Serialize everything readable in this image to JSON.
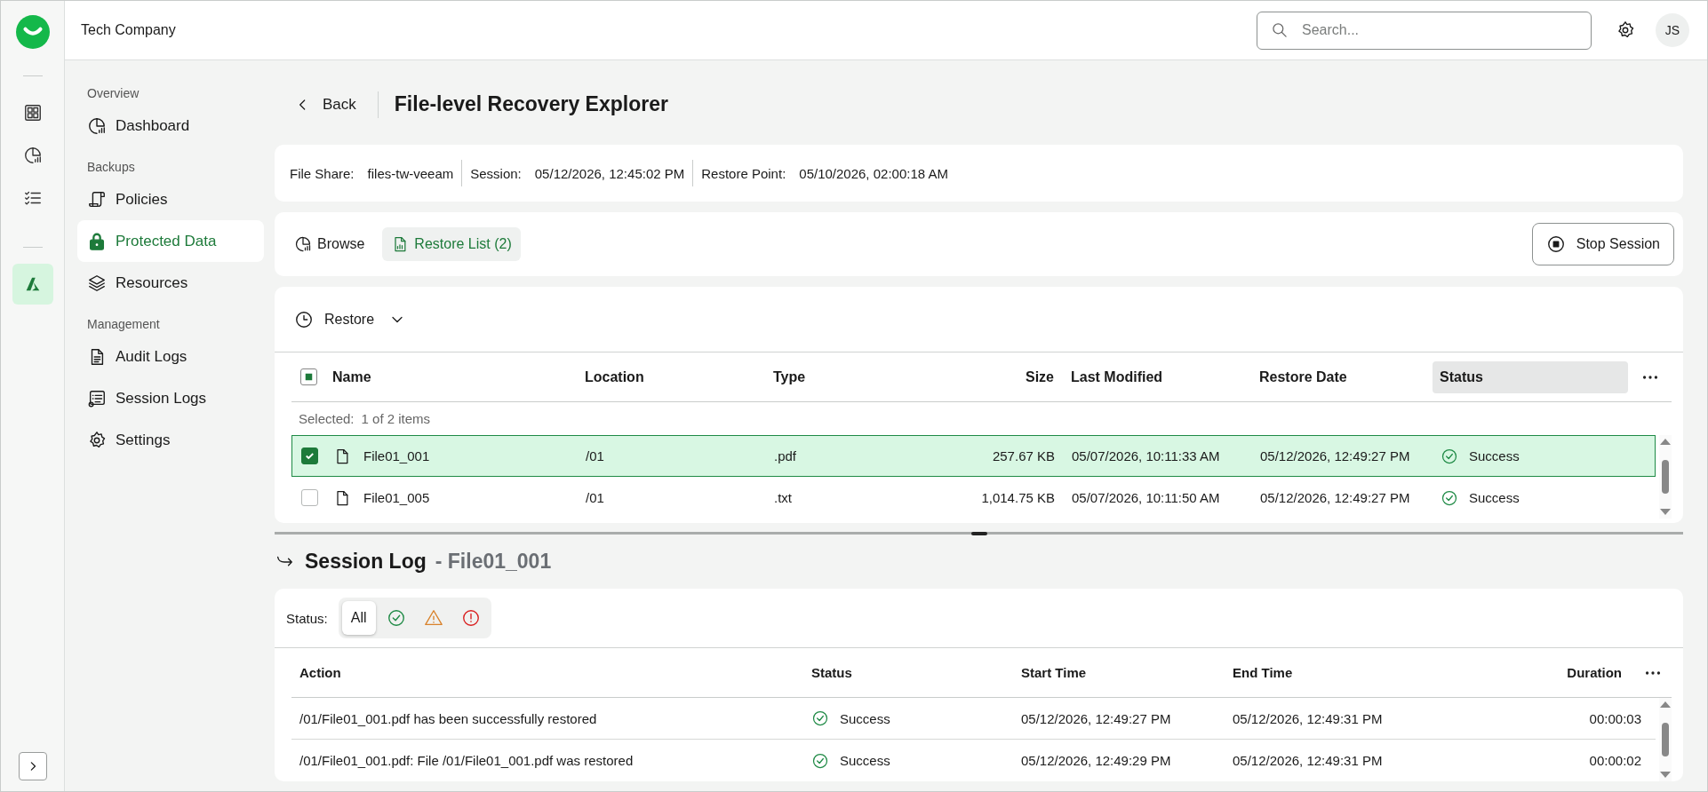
{
  "header": {
    "company": "Tech Company",
    "search_placeholder": "Search...",
    "avatar": "JS"
  },
  "rail": [
    {
      "kind": "grid",
      "selected": false
    },
    {
      "kind": "chart",
      "selected": false
    },
    {
      "kind": "checklist",
      "selected": false
    },
    {
      "kind": "azure",
      "selected": true
    }
  ],
  "sidebar": [
    {
      "label": "Overview",
      "items": [
        {
          "kind": "chart",
          "label": "Dashboard",
          "selected": false
        }
      ]
    },
    {
      "label": "Backups",
      "items": [
        {
          "kind": "scroll",
          "label": "Policies",
          "selected": false
        },
        {
          "kind": "lock",
          "label": "Protected Data",
          "selected": true
        },
        {
          "kind": "layers",
          "label": "Resources",
          "selected": false
        }
      ]
    },
    {
      "label": "Management",
      "items": [
        {
          "kind": "doc",
          "label": "Audit Logs",
          "selected": false
        },
        {
          "kind": "log",
          "label": "Session Logs",
          "selected": false
        },
        {
          "kind": "gear",
          "label": "Settings",
          "selected": false
        }
      ]
    }
  ],
  "page": {
    "back": "Back",
    "title": "File-level Recovery Explorer"
  },
  "info": [
    {
      "label": "File Share:",
      "value": "files-tw-veeam"
    },
    {
      "label": "Session:",
      "value": "05/12/2026, 12:45:02 PM"
    },
    {
      "label": "Restore Point:",
      "value": "05/10/2026, 02:00:18 AM"
    }
  ],
  "tabs": [
    {
      "kind": "chart",
      "label": "Browse",
      "selected": false
    },
    {
      "kind": "report",
      "label": "Restore List (2)",
      "selected": true
    }
  ],
  "stop_button": "Stop Session",
  "restore_menu": "Restore",
  "files": {
    "select_all": {
      "checked": true,
      "partial": true
    },
    "columns": [
      {
        "label": "Name",
        "kind": "text",
        "highlighted": false
      },
      {
        "label": "Location",
        "kind": "text",
        "highlighted": false
      },
      {
        "label": "Type",
        "kind": "text",
        "highlighted": false
      },
      {
        "label": "Size",
        "kind": "number",
        "highlighted": false
      },
      {
        "label": "Last Modified",
        "kind": "text",
        "highlighted": false
      },
      {
        "label": "Restore Date",
        "kind": "text",
        "highlighted": false
      },
      {
        "label": "Status",
        "kind": "text",
        "highlighted": true
      }
    ],
    "selection_label": "Selected:",
    "selection_count": "1 of 2 items",
    "rows": [
      {
        "name": "File01_001",
        "location": "/01",
        "type": ".pdf",
        "size": "257.67 KB",
        "modified": "05/07/2026, 10:11:33 AM",
        "restored": "05/12/2026, 12:49:27 PM",
        "status": {
          "kind": "success",
          "label": "Success"
        },
        "selected": true,
        "checked": true
      },
      {
        "name": "File01_005",
        "location": "/01",
        "type": ".txt",
        "size": "1,014.75 KB",
        "modified": "05/07/2026, 10:11:50 AM",
        "restored": "05/12/2026, 12:49:27 PM",
        "status": {
          "kind": "success",
          "label": "Success"
        },
        "selected": false,
        "checked": false
      }
    ]
  },
  "session_log": {
    "title": "Session Log",
    "subject": "- File01_001",
    "status_label": "Status:",
    "filters": [
      {
        "kind": "all",
        "label": "All",
        "selected": true
      },
      {
        "kind": "success",
        "selected": false
      },
      {
        "kind": "warning",
        "selected": false
      },
      {
        "kind": "error",
        "selected": false
      }
    ],
    "columns": [
      {
        "label": "Action",
        "kind": "text"
      },
      {
        "label": "Status",
        "kind": "text"
      },
      {
        "label": "Start Time",
        "kind": "text"
      },
      {
        "label": "End Time",
        "kind": "text"
      },
      {
        "label": "Duration",
        "kind": "number"
      }
    ],
    "rows": [
      {
        "action": "/01/File01_001.pdf has been successfully restored",
        "status": {
          "kind": "success",
          "label": "Success"
        },
        "start": "05/12/2026, 12:49:27 PM",
        "end": "05/12/2026, 12:49:31 PM",
        "duration": "00:00:03"
      },
      {
        "action": "/01/File01_001.pdf: File /01/File01_001.pdf was restored",
        "status": {
          "kind": "success",
          "label": "Success"
        },
        "start": "05/12/2026, 12:49:29 PM",
        "end": "05/12/2026, 12:49:31 PM",
        "duration": "00:00:02"
      }
    ]
  }
}
